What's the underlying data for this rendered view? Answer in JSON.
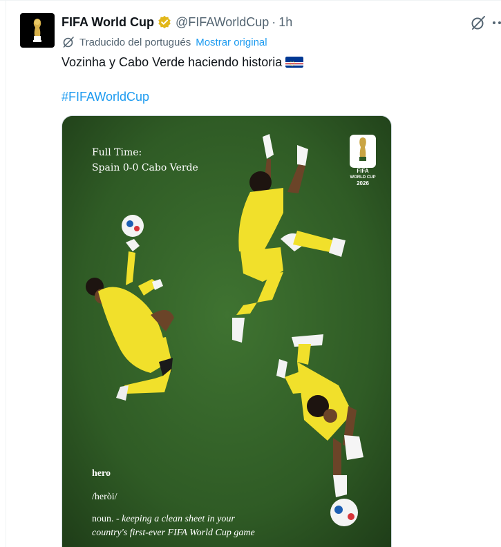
{
  "tweet": {
    "author": {
      "display_name": "FIFA World Cup",
      "handle": "@FIFAWorldCup",
      "separator": "·",
      "time": "1h",
      "verified_color": "#e2b719"
    },
    "translation": {
      "label": "Traducido del portugués",
      "show_original": "Mostrar original"
    },
    "text": "Vozinha y Cabo Verde haciendo historia",
    "flag_icon": "cape-verde-flag-icon",
    "hashtag": "#FIFAWorldCup",
    "media": {
      "full_time_label": "Full Time:",
      "score": "Spain 0-0 Cabo Verde",
      "logo_fifa": "FIFA",
      "logo_world_cup": "WORLD CUP",
      "logo_year": "2026",
      "definition_word": "hero",
      "definition_pronunciation": "/heròi/",
      "definition_pos": "noun.",
      "definition_text_1": "- keeping a clean sheet in your",
      "definition_text_2": "country's first-ever FIFA World Cup game"
    }
  },
  "colors": {
    "link": "#1d9bf0",
    "secondary_text": "#536471",
    "pitch": "#2f5a24",
    "kit": "#f1e02b"
  }
}
